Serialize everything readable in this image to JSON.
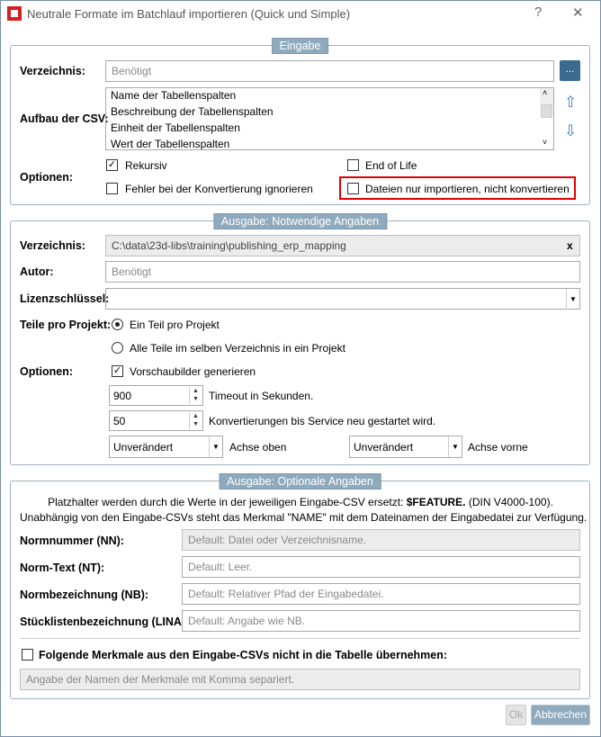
{
  "window": {
    "title": "Neutrale Formate im Batchlauf importieren (Quick und Simple)",
    "help": "?",
    "close": "✕"
  },
  "eingabe": {
    "legend": "Eingabe",
    "verzeichnis_label": "Verzeichnis:",
    "verzeichnis_placeholder": "Benötigt",
    "browse": "...",
    "aufbau_label": "Aufbau der CSV:",
    "csv_items": [
      "Name der Tabellenspalten",
      "Beschreibung der Tabellenspalten",
      "Einheit der Tabellenspalten",
      "Wert der Tabellenspalten"
    ],
    "optionen_label": "Optionen:",
    "rekursiv": "Rekursiv",
    "rekursiv_checked": true,
    "end_of_life": "End of Life",
    "fehler": "Fehler bei der Konvertierung ignorieren",
    "nur_importieren": "Dateien nur importieren, nicht konvertieren"
  },
  "notwendig": {
    "legend": "Ausgabe: Notwendige Angaben",
    "verzeichnis_label": "Verzeichnis:",
    "verzeichnis_value": "C:\\data\\23d-libs\\training\\publishing_erp_mapping",
    "clear": "x",
    "autor_label": "Autor:",
    "autor_placeholder": "Benötigt",
    "lizenz_label": "Lizenzschlüssel:",
    "teile_label": "Teile pro Projekt:",
    "radio1": "Ein Teil pro Projekt",
    "radio2": "Alle Teile im selben Verzeichnis in ein Projekt",
    "optionen_label": "Optionen:",
    "vorschau": "Vorschaubilder generieren",
    "timeout_value": "900",
    "timeout_label": "Timeout in Sekunden.",
    "konv_value": "50",
    "konv_label": "Konvertierungen bis Service neu gestartet wird.",
    "achse_oben_value": "Unverändert",
    "achse_oben_label": "Achse oben",
    "achse_vorne_value": "Unverändert",
    "achse_vorne_label": "Achse vorne"
  },
  "optional": {
    "legend": "Ausgabe: Optionale Angaben",
    "info1_pre": "Platzhalter werden durch die Werte in der jeweiligen Eingabe-CSV ersetzt: ",
    "info1_bold": "$FEATURE.",
    "info1_post": " (DIN V4000-100).",
    "info2": "Unabhängig von den Eingabe-CSVs steht das Merkmal \"NAME\" mit dem Dateinamen der Eingabedatei zur Verfügung.",
    "nn_label": "Normnummer (NN):",
    "nn_placeholder": "Default: Datei oder Verzeichnisname.",
    "nt_label": "Norm-Text (NT):",
    "nt_placeholder": "Default: Leer.",
    "nb_label": "Normbezeichnung (NB):",
    "nb_placeholder": "Default: Relativer Pfad der Eingabedatei.",
    "lina_label": "Stücklistenbezeichnung (LINA):",
    "lina_placeholder": "Default: Angabe wie NB.",
    "merkmale_label": "Folgende Merkmale aus den Eingabe-CSVs nicht in die Tabelle übernehmen:",
    "merkmale_placeholder": "Angabe der Namen der Merkmale mit Komma separiert."
  },
  "buttons": {
    "ok": "Ok",
    "cancel": "Abbrechen"
  },
  "colors": {
    "accent": "#8faabd",
    "highlight": "#e00000"
  }
}
